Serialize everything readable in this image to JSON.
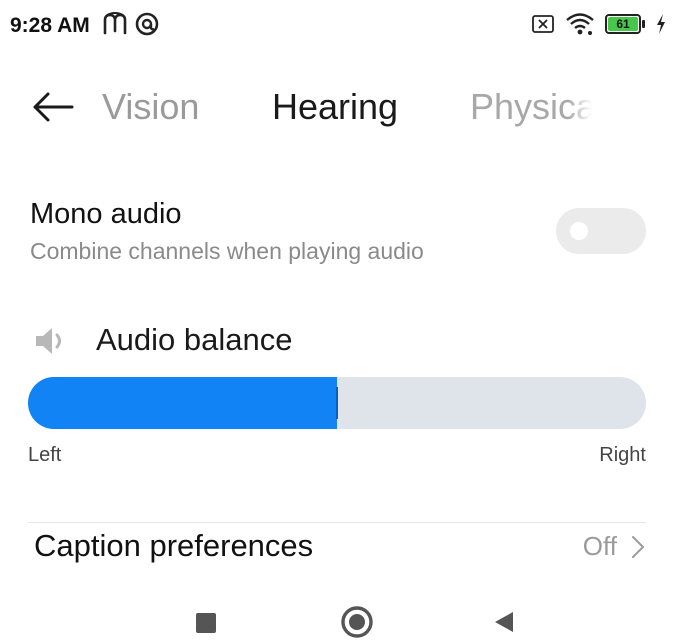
{
  "status_bar": {
    "time": "9:28 AM",
    "battery_level": "61",
    "icons": [
      "m-app-icon",
      "at-sign-icon",
      "sim-off-icon",
      "wifi-icon",
      "battery-icon",
      "charging-icon"
    ]
  },
  "tabs": {
    "back_label": "Back",
    "items": [
      {
        "label": "Vision",
        "selected": false
      },
      {
        "label": "Hearing",
        "selected": true
      },
      {
        "label": "Physical",
        "selected": false
      }
    ]
  },
  "mono_audio": {
    "title": "Mono audio",
    "subtitle": "Combine channels when playing audio",
    "enabled": false
  },
  "audio_balance": {
    "title": "Audio balance",
    "value_fraction": 0.5,
    "left_label": "Left",
    "right_label": "Right"
  },
  "caption_preferences": {
    "title": "Caption preferences",
    "value": "Off"
  },
  "colors": {
    "accent": "#1283f4",
    "track": "#dfe3ea",
    "toggle_off": "#ebebeb"
  },
  "nav_bar": {
    "buttons": [
      "recents-button",
      "home-button",
      "back-button"
    ]
  }
}
